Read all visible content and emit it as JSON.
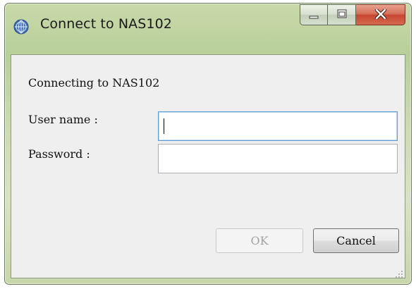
{
  "window": {
    "title": "Connect to NAS102",
    "icon": "globe-network-icon",
    "controls": {
      "minimize": "minimize-icon",
      "maximize": "maximize-icon",
      "close": "close-icon"
    }
  },
  "dialog": {
    "message": "Connecting to NAS102",
    "fields": {
      "username_label": "User name :",
      "username_value": "",
      "password_label": "Password :",
      "password_value": ""
    },
    "buttons": {
      "ok": "OK",
      "cancel": "Cancel"
    },
    "ok_enabled": false
  },
  "colors": {
    "frame_accent": "#c8d6aa",
    "close_button": "#c7472f",
    "client_bg": "#efefef",
    "focus_border": "#5b9bd5"
  }
}
